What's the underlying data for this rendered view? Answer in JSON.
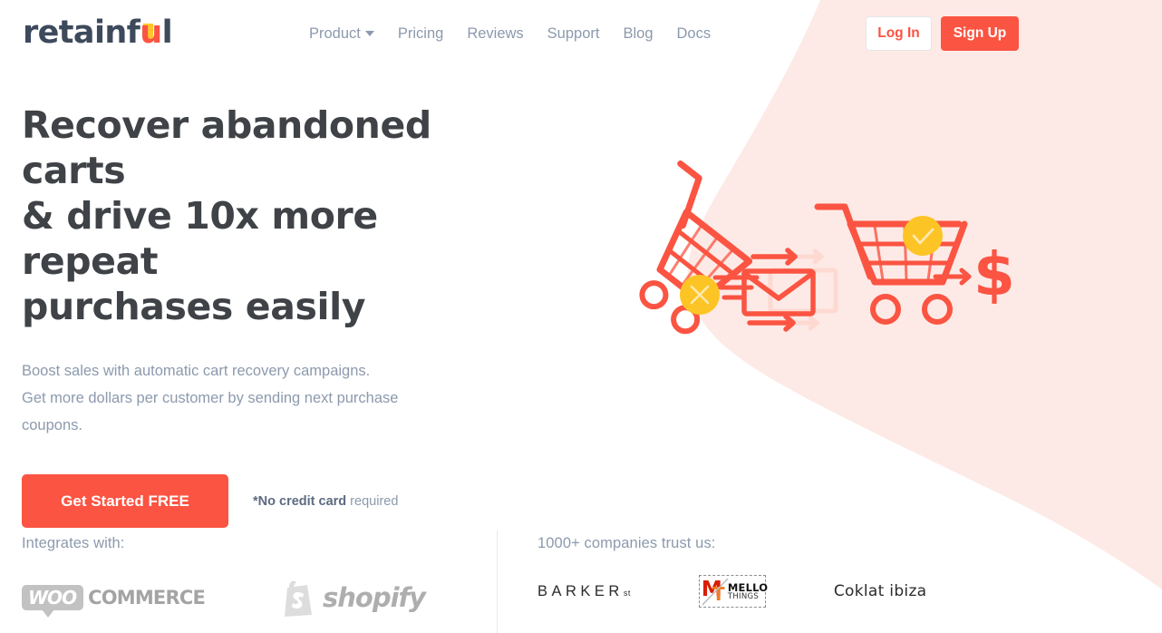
{
  "brand": {
    "logo_part1": "retainf",
    "logo_u": "u",
    "logo_part2": "l",
    "accent_color": "#fb5442",
    "accent_yellow": "#ffc72c",
    "blob_color": "#fdeae6",
    "nav_text_color": "#8c9aad",
    "headline_color": "#3f4246"
  },
  "nav": {
    "items": [
      {
        "label": "Product",
        "has_dropdown": true
      },
      {
        "label": "Pricing",
        "has_dropdown": false
      },
      {
        "label": "Reviews",
        "has_dropdown": false
      },
      {
        "label": "Support",
        "has_dropdown": false
      },
      {
        "label": "Blog",
        "has_dropdown": false
      },
      {
        "label": "Docs",
        "has_dropdown": false
      }
    ]
  },
  "auth": {
    "login_label": "Log In",
    "signup_label": "Sign Up"
  },
  "hero": {
    "headline_line1": "Recover abandoned carts",
    "headline_line2": "& drive 10x more repeat",
    "headline_line3": "purchases easily",
    "subhead_line1": "Boost sales with automatic cart recovery campaigns.",
    "subhead_line2": "Get more dollars per customer by sending next purchase",
    "subhead_line3": "coupons.",
    "cta_label": "Get Started FREE",
    "note_bold": "*No credit card",
    "note_rest": " required",
    "illustration_alt": "abandoned-cart-email-recovery-illustration",
    "dollar_symbol": "$"
  },
  "integrations": {
    "label": "Integrates with:",
    "logos": [
      {
        "name": "woocommerce",
        "badge": "WOO",
        "text": "COMMERCE"
      },
      {
        "name": "shopify",
        "text": "shopify"
      }
    ]
  },
  "trust": {
    "label": "1000+ companies trust us:",
    "logos": [
      {
        "name": "barker-st",
        "text": "BARKER",
        "sub": "st"
      },
      {
        "name": "mello-things",
        "mark_m": "M",
        "mark_t": "T",
        "line1": "MELLO",
        "line2": "THINGS"
      },
      {
        "name": "coklat-ibiza",
        "text": "Coklat ibiza"
      }
    ]
  }
}
